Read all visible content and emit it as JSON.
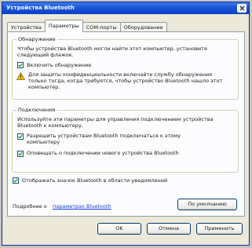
{
  "window": {
    "title": "Устройства Bluetooth"
  },
  "tabs": [
    "Устройства",
    "Параметры",
    "COM-порты",
    "Оборудование"
  ],
  "discovery": {
    "legend": "Обнаружение",
    "description": "Чтобы устройства Bluetooth могли найти этот компьютер, установите следующий флажок.",
    "checkbox_label": "Включить обнаружение",
    "checked": true,
    "warning": "Для защиты конфиденциальности включайте службу обнаружения только тогда, когда требуется, чтобы устройство Bluetooth нашло этот компьютер."
  },
  "connections": {
    "legend": "Подключения",
    "description": "Используйте эти параметры для управления подключением устройства Bluetooth к компьютеру.",
    "allow_label": "Разрешить устройствам Bluetooth подключаться к этому компьютеру",
    "allow_checked": true,
    "notify_label": "Оповещать о подключении нового устройства Bluetooth",
    "notify_checked": true
  },
  "show_icon": {
    "label": "Отображать значок Bluetooth в области уведомлений",
    "checked": true
  },
  "footer": {
    "more_prefix": "Подробнее о",
    "more_link": "параметрах Bluetooth",
    "defaults_button": "По умолчанию"
  },
  "buttons": {
    "ok": "OK",
    "cancel": "Отмена",
    "apply": "Применить"
  },
  "colors": {
    "titlebar": "#1c55d8",
    "link": "#0b3ed8",
    "dialog": "#ece9d8"
  }
}
